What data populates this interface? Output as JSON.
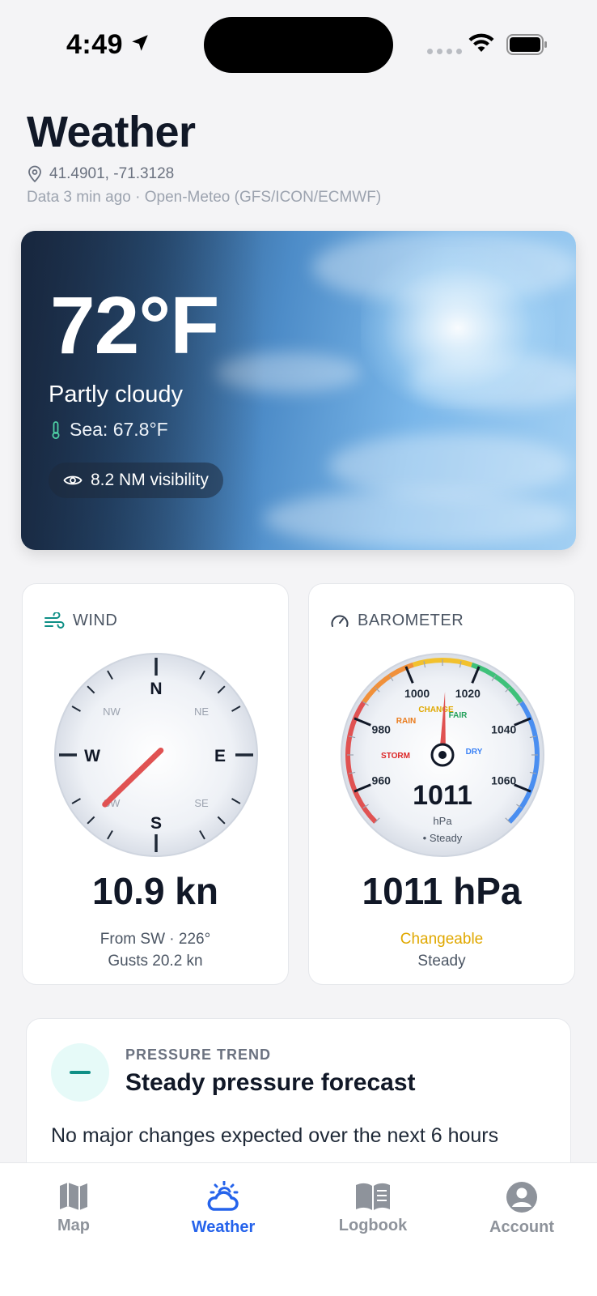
{
  "status_bar": {
    "time": "4:49"
  },
  "header": {
    "title": "Weather",
    "coordinates": "41.4901, -71.3128",
    "data_meta": "Data 3 min ago · Open-Meteo (GFS/ICON/ECMWF)"
  },
  "hero": {
    "temperature": "72°F",
    "condition": "Partly cloudy",
    "sea_temp": "Sea: 67.8°F",
    "visibility": "8.2 NM visibility"
  },
  "wind": {
    "label": "WIND",
    "value": "10.9 kn",
    "from": "From SW · 226°",
    "gusts": "Gusts 20.2 kn",
    "direction_deg": 226,
    "compass": {
      "n": "N",
      "e": "E",
      "s": "S",
      "w": "W",
      "ne": "NE",
      "nw": "NW",
      "se": "SE",
      "sw": "SW"
    }
  },
  "barometer": {
    "label": "BAROMETER",
    "value": "1011 hPa",
    "status": "Changeable",
    "trend": "Steady",
    "dial": {
      "reading": "1011",
      "unit": "hPa",
      "trend": "• Steady",
      "pressure_hpa": 1011,
      "scale_min": 950,
      "scale_max": 1070,
      "ticks": [
        "960",
        "980",
        "1000",
        "1020",
        "1040",
        "1060"
      ],
      "zones": {
        "storm": "STORM",
        "rain": "RAIN",
        "change": "CHANGE",
        "fair": "FAIR",
        "dry": "DRY"
      }
    }
  },
  "pressure_trend": {
    "label": "PRESSURE TREND",
    "title": "Steady pressure forecast",
    "description": "No major changes expected over the next 6 hours"
  },
  "tabs": [
    {
      "label": "Map",
      "icon": "map-icon"
    },
    {
      "label": "Weather",
      "icon": "weather-icon"
    },
    {
      "label": "Logbook",
      "icon": "logbook-icon"
    },
    {
      "label": "Account",
      "icon": "account-icon"
    }
  ],
  "colors": {
    "accent": "#2563eb",
    "teal": "#0f8f86",
    "changeable": "#e0a800",
    "needle": "#e05252"
  }
}
